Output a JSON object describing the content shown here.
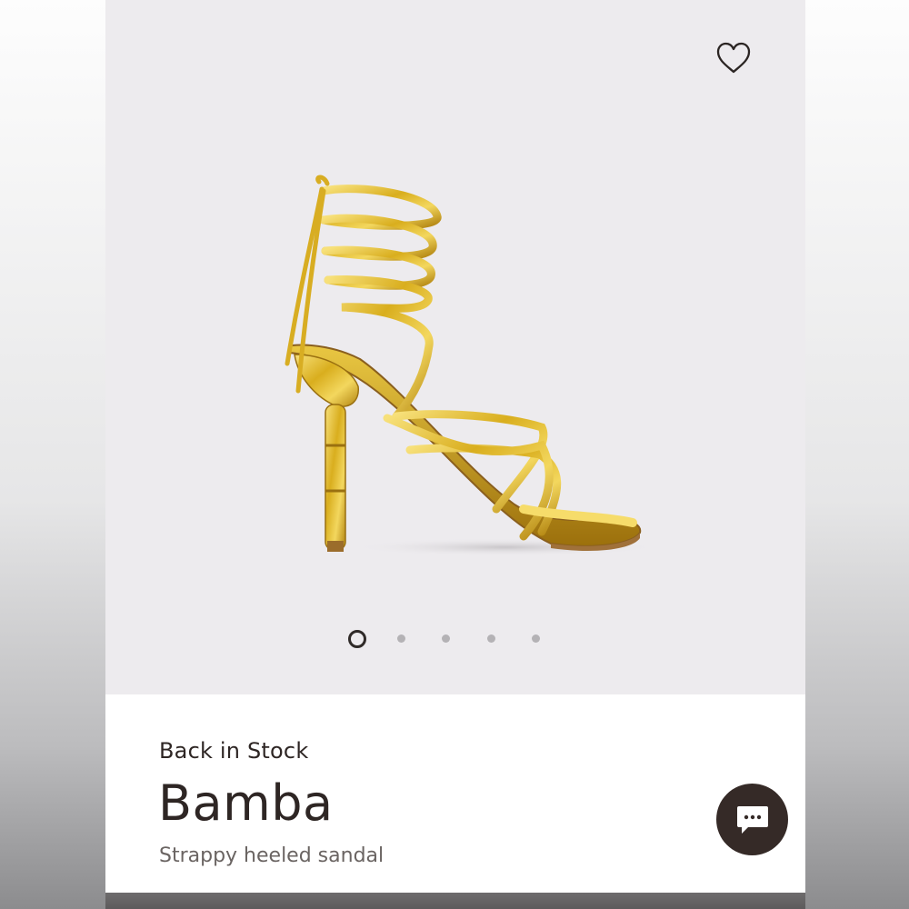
{
  "product": {
    "availability": "Back in Stock",
    "name": "Bamba",
    "description": "Strappy heeled sandal"
  },
  "gallery": {
    "image_count": 5,
    "active_index": 0
  },
  "icons": {
    "favorite": "heart-outline-icon",
    "chat": "chat-bubble-icon"
  },
  "colors": {
    "hero_background": "#edebee",
    "text_primary": "#2e2624",
    "text_secondary": "#6a6462",
    "chat_button": "#352a27",
    "dot_inactive": "#b4b2b5"
  }
}
